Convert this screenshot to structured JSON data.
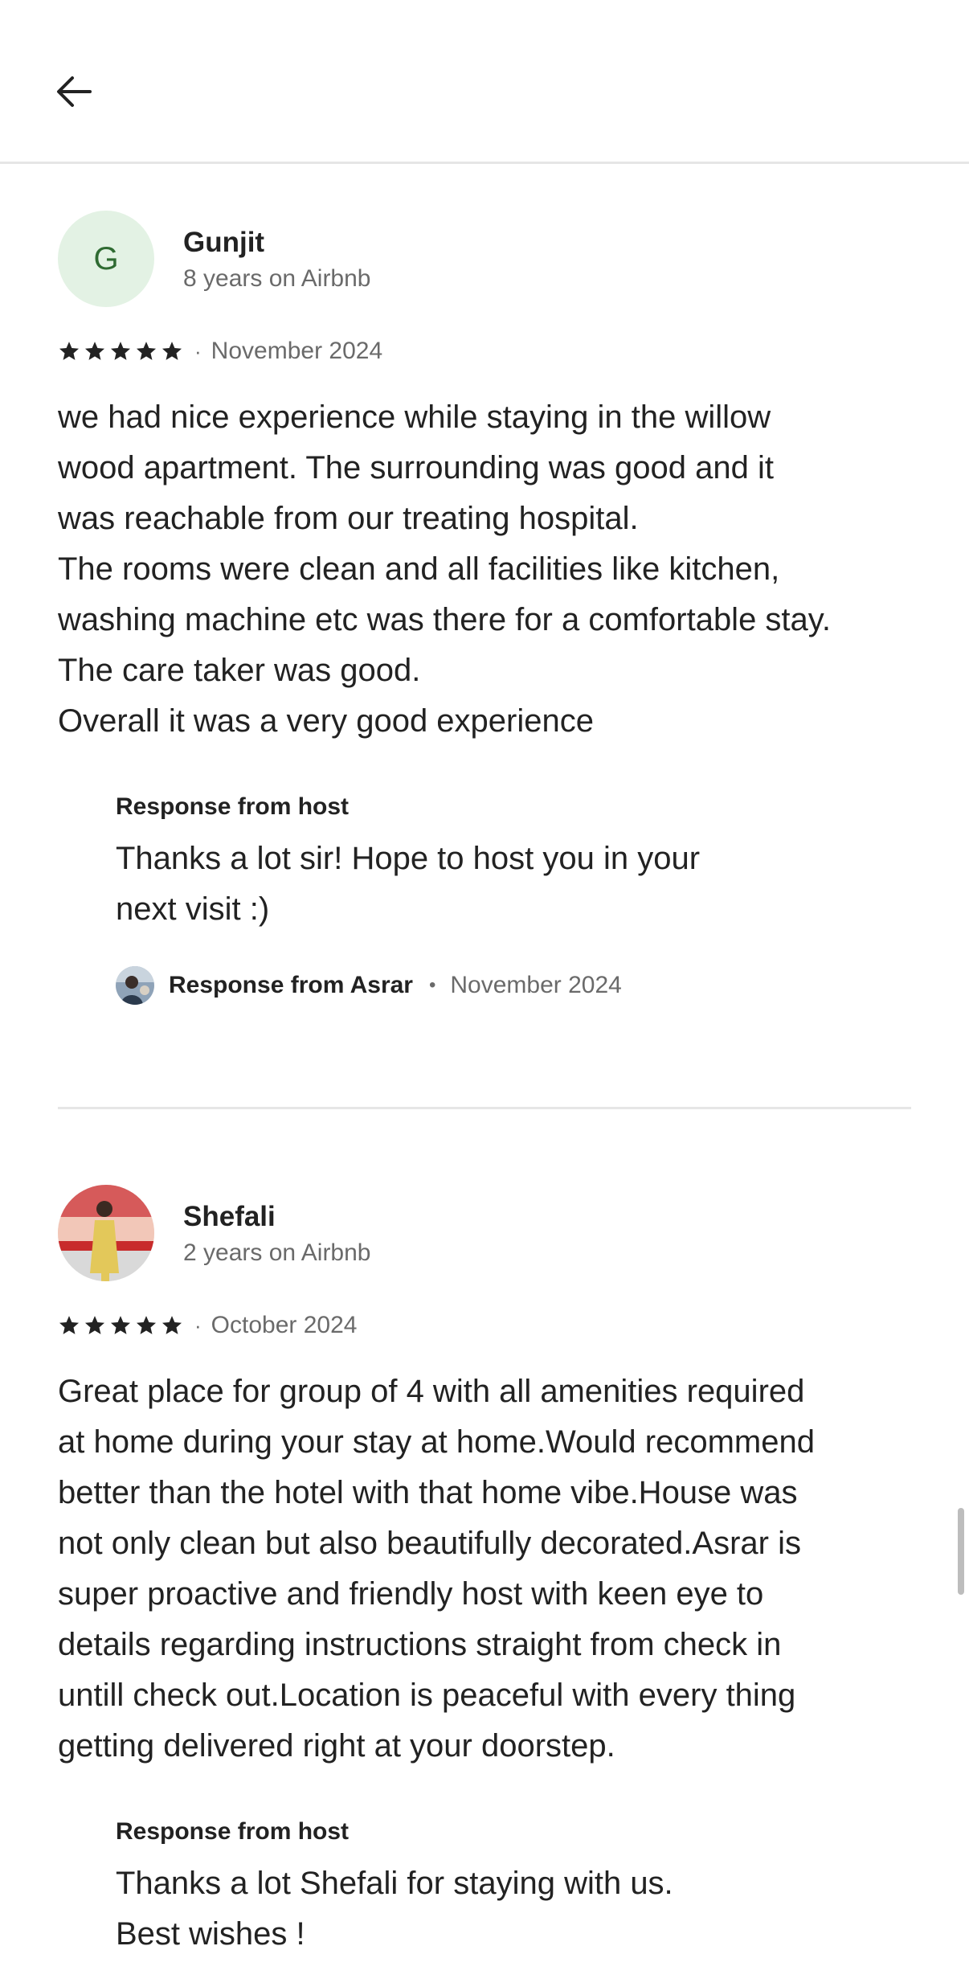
{
  "header": {
    "back_icon": "arrow-left-icon"
  },
  "reviews": [
    {
      "avatar_letter": "G",
      "name": "Gunjit",
      "tenure": "8 years on Airbnb",
      "rating": 5,
      "separator": "·",
      "date": "November 2024",
      "text": "we had  nice experience while staying in the willow\nwood apartment. The surrounding was good and it\nwas reachable from our treating hospital.\nThe rooms were clean and all facilities like kitchen,\nwashing machine etc was there for a comfortable stay.\nThe care taker was good.\nOverall it was a very good experience",
      "response": {
        "heading": "Response from host",
        "text": "Thanks a lot sir! Hope to host you in your\nnext visit :)",
        "host_label": "Response from Asrar",
        "separator": "•",
        "date": "November 2024"
      }
    },
    {
      "name": "Shefali",
      "tenure": "2 years on Airbnb",
      "rating": 5,
      "separator": "·",
      "date": "October 2024",
      "text": "Great place for group of 4 with all amenities required\nat home during your stay at home.Would recommend\nbetter than the hotel with that home vibe.House was\nnot only clean but also beautifully decorated.Asrar is\nsuper proactive and friendly host with keen eye to\ndetails regarding instructions straight from check in\nuntill check out.Location is peaceful with every thing\ngetting delivered right at your doorstep.",
      "response": {
        "heading": "Response from host",
        "text": "Thanks a lot Shefali for staying with us.\nBest wishes !"
      }
    }
  ],
  "colors": {
    "text_primary": "#222222",
    "text_secondary": "#6a6a6a",
    "divider": "#e6e6e6",
    "avatar_bg": "#e3f2e4",
    "avatar_letter": "#2f6b32"
  }
}
